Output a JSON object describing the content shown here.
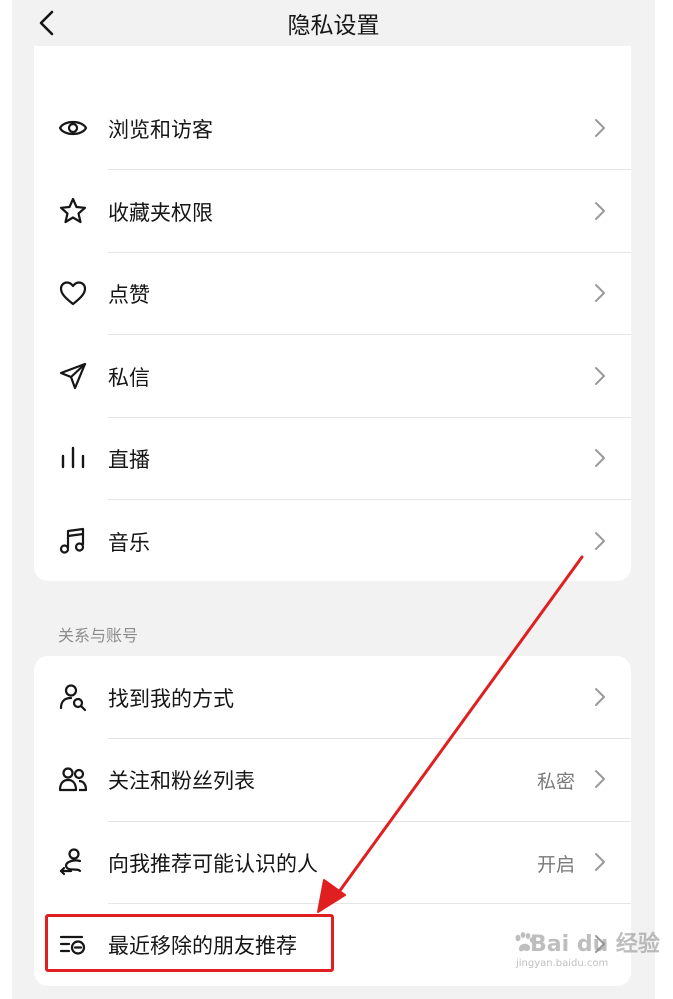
{
  "header": {
    "title": "隐私设置"
  },
  "card1": {
    "items": [
      {
        "label": "浏览和访客",
        "icon": "eye-icon"
      },
      {
        "label": "收藏夹权限",
        "icon": "star-icon"
      },
      {
        "label": "点赞",
        "icon": "heart-icon"
      },
      {
        "label": "私信",
        "icon": "paper-plane-icon"
      },
      {
        "label": "直播",
        "icon": "live-bars-icon"
      },
      {
        "label": "音乐",
        "icon": "music-note-icon"
      }
    ]
  },
  "section2": {
    "title": "关系与账号",
    "items": [
      {
        "label": "找到我的方式",
        "value": "",
        "icon": "user-search-icon"
      },
      {
        "label": "关注和粉丝列表",
        "value": "私密",
        "icon": "users-icon"
      },
      {
        "label": "向我推荐可能认识的人",
        "value": "开启",
        "icon": "recommend-path-icon"
      },
      {
        "label": "最近移除的朋友推荐",
        "value": "",
        "icon": "list-removed-icon"
      }
    ]
  },
  "watermark": {
    "main": "Bai du 经验",
    "sub": "jingyan.baidu.com"
  },
  "colors": {
    "background": "#f2f2f2",
    "card": "#ffffff",
    "highlight": "#e02020",
    "text": "#161616",
    "secondary": "#7a7a7a"
  }
}
